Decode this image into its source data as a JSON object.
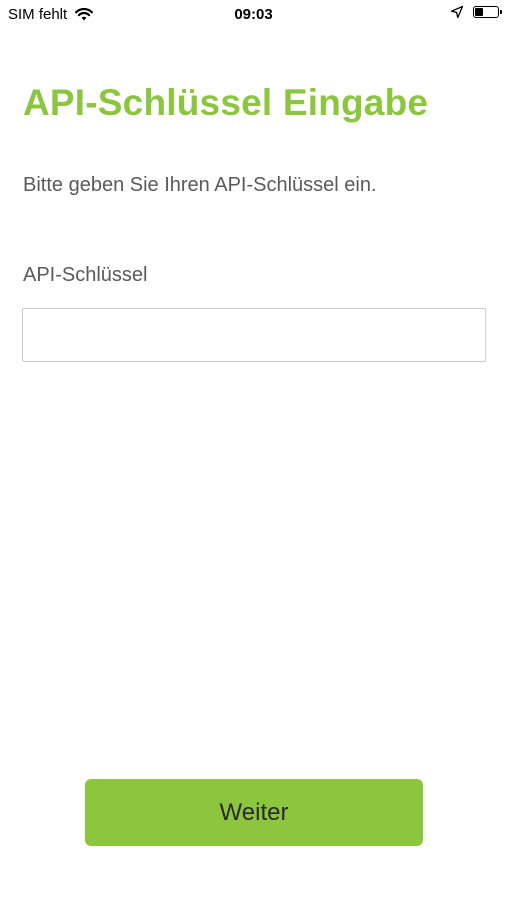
{
  "status_bar": {
    "carrier": "SIM fehlt",
    "time": "09:03",
    "icons": [
      "wifi-icon",
      "location-icon",
      "battery-icon"
    ]
  },
  "main": {
    "title": "API-Schlüssel Eingabe",
    "instruction": "Bitte geben Sie Ihren API-Schlüssel ein.",
    "field_label": "API-Schlüssel",
    "api_key_value": "",
    "api_key_placeholder": ""
  },
  "footer": {
    "continue_label": "Weiter"
  },
  "colors": {
    "accent": "#8cc63f",
    "text_secondary": "#5a5a5a",
    "input_border": "#cccccc"
  }
}
